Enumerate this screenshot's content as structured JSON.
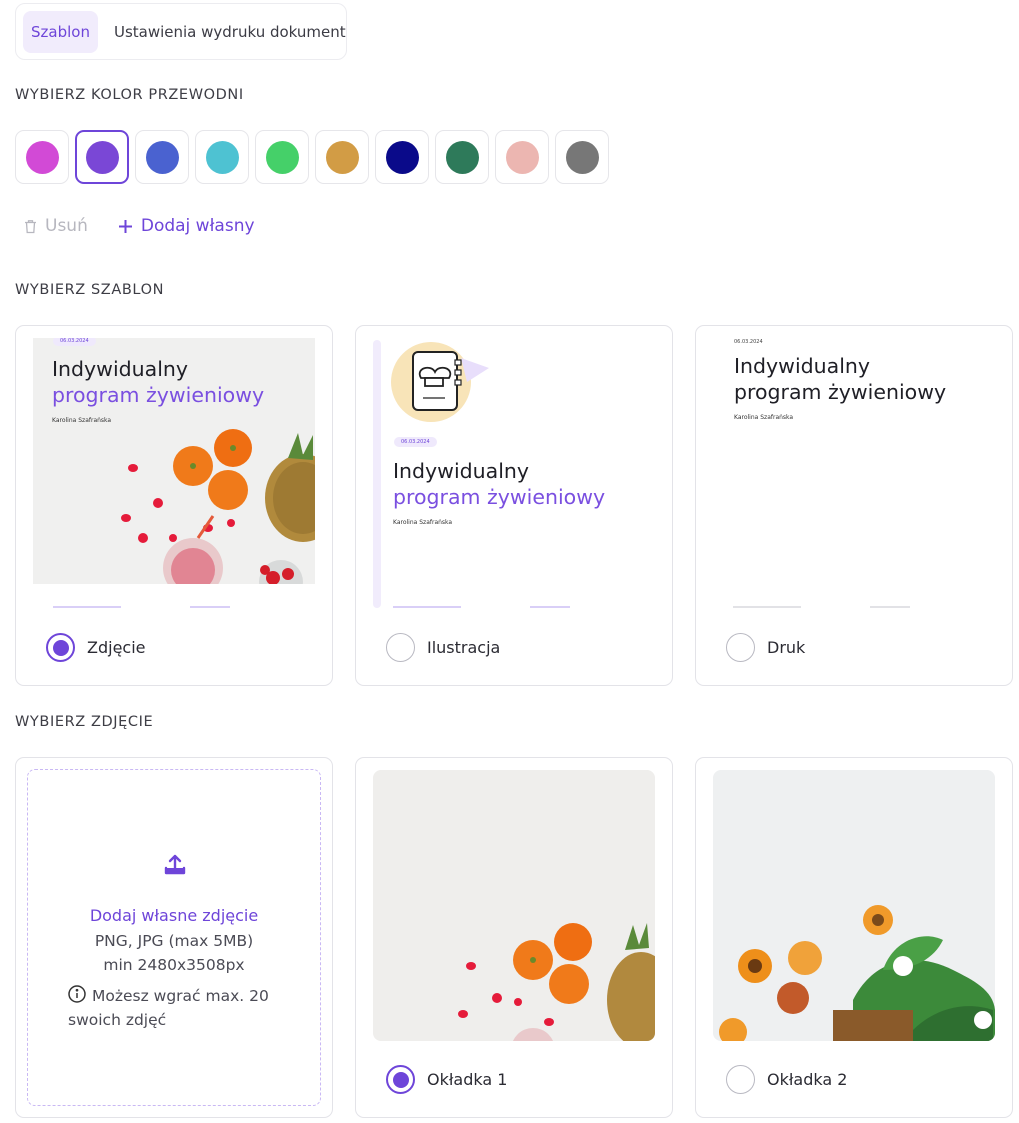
{
  "tabs": [
    {
      "label": "Szablon",
      "active": true
    },
    {
      "label": "Ustawienia wydruku dokument",
      "active": false
    }
  ],
  "sections": {
    "color": "WYBIERZ KOLOR PRZEWODNI",
    "template": "WYBIERZ SZABLON",
    "photo": "WYBIERZ ZDJĘCIE"
  },
  "colors": {
    "selected_index": 1,
    "swatches": [
      "#d24ad6",
      "#7a47d6",
      "#4a62d0",
      "#4ec2d2",
      "#45d069",
      "#d29c45",
      "#0a0a8a",
      "#2e7a5a",
      "#ecb6b1",
      "#777777"
    ]
  },
  "actions": {
    "delete_label": "Usuń",
    "add_label": "Dodaj własny"
  },
  "template_preview": {
    "date": "06.03.2024",
    "title_line1": "Indywidualny",
    "title_line2": "program żywieniowy",
    "author": "Karolina Szafrańska"
  },
  "templates": [
    {
      "label": "Zdjęcie",
      "selected": true
    },
    {
      "label": "Ilustracja",
      "selected": false
    },
    {
      "label": "Druk",
      "selected": false
    }
  ],
  "upload": {
    "title": "Dodaj własne zdjęcie",
    "formats": "PNG, JPG (max 5MB)",
    "min_size": "min 2480x3508px",
    "info_line1": "Możesz wgrać max. 20",
    "info_line2": "swoich zdjęć"
  },
  "photos": [
    {
      "label": "Okładka 1",
      "selected": true
    },
    {
      "label": "Okładka 2",
      "selected": false
    }
  ],
  "accent_color": "#6e45d9"
}
